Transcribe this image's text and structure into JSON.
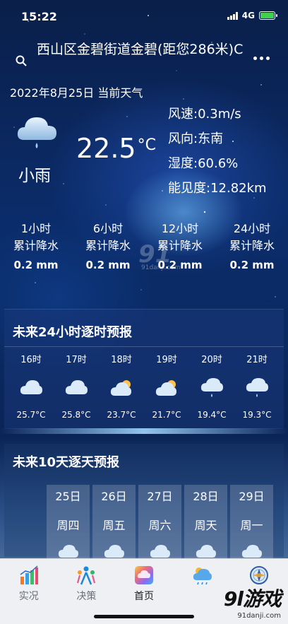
{
  "status_bar": {
    "time": "15:22",
    "network": "4G"
  },
  "header": {
    "location": "西山区金碧街道金碧(距您286米)C",
    "date_line": "2022年8月25日 当前天气"
  },
  "current": {
    "condition": "小雨",
    "temperature": "22.5",
    "temp_unit": "°C",
    "details": [
      "风速:0.3m/s",
      "风向:东南",
      "湿度:60.6%",
      "能见度:12.82km"
    ]
  },
  "precipitation": [
    {
      "period": "1小时",
      "label": "累计降水",
      "value": "0.2 mm"
    },
    {
      "period": "6小时",
      "label": "累计降水",
      "value": "0.2 mm"
    },
    {
      "period": "12小时",
      "label": "累计降水",
      "value": "0.2 mm"
    },
    {
      "period": "24小时",
      "label": "累计降水",
      "value": "0.2 mm"
    }
  ],
  "hourly": {
    "title": "未来24小时逐时预报",
    "items": [
      {
        "time": "16时",
        "icon": "cloud-icon",
        "temp": "25.7°C"
      },
      {
        "time": "17时",
        "icon": "cloud-icon",
        "temp": "25.8°C"
      },
      {
        "time": "18时",
        "icon": "partly-cloudy-icon",
        "temp": "23.7°C"
      },
      {
        "time": "19时",
        "icon": "partly-cloudy-icon",
        "temp": "21.7°C"
      },
      {
        "time": "20时",
        "icon": "light-rain-icon",
        "temp": "19.4°C"
      },
      {
        "time": "21时",
        "icon": "light-rain-icon",
        "temp": "19.3°C"
      }
    ]
  },
  "daily": {
    "title": "未来10天逐天预报",
    "items": [
      {
        "date": "25日",
        "weekday": "周四"
      },
      {
        "date": "26日",
        "weekday": "周五"
      },
      {
        "date": "27日",
        "weekday": "周六"
      },
      {
        "date": "28日",
        "weekday": "周天"
      },
      {
        "date": "29日",
        "weekday": "周一"
      }
    ]
  },
  "nav": [
    {
      "label": "实况",
      "icon": "bar-chart-icon"
    },
    {
      "label": "决策",
      "icon": "people-icon"
    },
    {
      "label": "首页",
      "icon": "home-icon"
    },
    {
      "label": "",
      "icon": "weather-radar-icon"
    },
    {
      "label": "",
      "icon": "compass-icon"
    }
  ],
  "watermark": {
    "brand": "9l游戏",
    "site": "91danji.com",
    "center_mark": "91",
    "center_site": "91danji.com"
  },
  "colors": {
    "accent": "#3ed34a",
    "nav_bg": "#eef0f3"
  }
}
